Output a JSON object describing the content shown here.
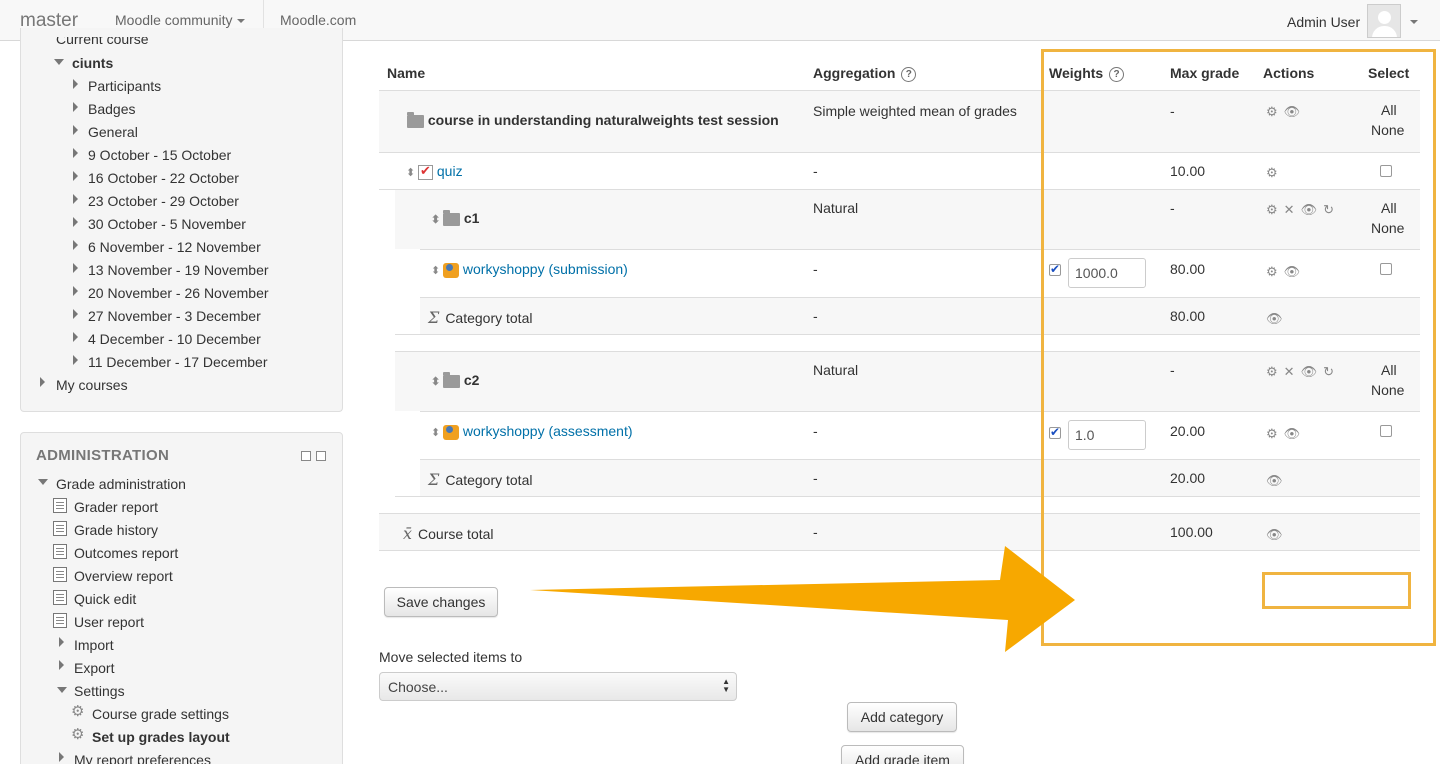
{
  "navbar": {
    "brand": "master",
    "menu_community": "Moodle community",
    "menu_moodle": "Moodle.com",
    "user_name": "Admin User"
  },
  "nav_block": {
    "current_course": "Current course",
    "course": "ciunts",
    "items": [
      "Participants",
      "Badges",
      "General",
      "9 October - 15 October",
      "16 October - 22 October",
      "23 October - 29 October",
      "30 October - 5 November",
      "6 November - 12 November",
      "13 November - 19 November",
      "20 November - 26 November",
      "27 November - 3 December",
      "4 December - 10 December",
      "11 December - 17 December"
    ],
    "my_courses": "My courses"
  },
  "admin_block": {
    "title": "ADMINISTRATION",
    "grade_admin": "Grade administration",
    "reports": [
      "Grader report",
      "Grade history",
      "Outcomes report",
      "Overview report",
      "Quick edit",
      "User report"
    ],
    "import": "Import",
    "export": "Export",
    "settings": "Settings",
    "course_grade_settings": "Course grade settings",
    "setup_layout": "Set up grades layout",
    "my_report_prefs": "My report preferences"
  },
  "table": {
    "headers": {
      "name": "Name",
      "aggregation": "Aggregation",
      "weights": "Weights",
      "max_grade": "Max grade",
      "actions": "Actions",
      "select": "Select"
    },
    "select_all": "All",
    "select_none": "None",
    "course_name": "course in understanding naturalweights test session",
    "course_aggregation": "Simple weighted mean of grades",
    "course_max": "-",
    "quiz_name": "quiz",
    "quiz_aggregation": "-",
    "quiz_max": "10.00",
    "c1_name": "c1",
    "c1_aggregation": "Natural",
    "c1_max": "-",
    "work_sub_name": "workyshoppy (submission)",
    "work_sub_aggregation": "-",
    "work_sub_weight": "1000.0",
    "work_sub_max": "80.00",
    "cat_total_label": "Category total",
    "cat_total1_aggregation": "-",
    "cat_total1_max": "80.00",
    "c2_name": "c2",
    "c2_aggregation": "Natural",
    "c2_max": "-",
    "work_ass_name": "workyshoppy (assessment)",
    "work_ass_aggregation": "-",
    "work_ass_weight": "1.0",
    "work_ass_max": "20.00",
    "cat_total2_aggregation": "-",
    "cat_total2_max": "20.00",
    "course_total_label": "Course total",
    "course_total_aggregation": "-",
    "course_total_max": "100.00"
  },
  "controls": {
    "save": "Save changes",
    "move_label": "Move selected items to",
    "move_selected": "Choose...",
    "add_category": "Add category",
    "add_grade_item": "Add grade item"
  },
  "colors": {
    "link": "#0070a8",
    "highlight": "#f0b440",
    "arrow": "#f7a800"
  }
}
